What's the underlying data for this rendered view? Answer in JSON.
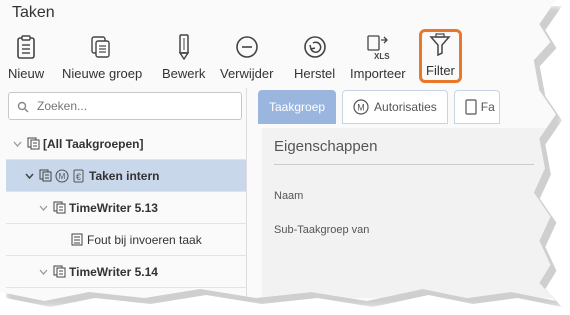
{
  "window": {
    "title": "Taken"
  },
  "toolbar": {
    "buttons": [
      {
        "id": "nieuw",
        "label": "Nieuw",
        "icon": "clipboard-icon"
      },
      {
        "id": "nieuwe-groep",
        "label": "Nieuwe groep",
        "icon": "stacked-clipboards-icon"
      },
      {
        "id": "bewerk",
        "label": "Bewerk",
        "icon": "pencil-icon"
      },
      {
        "id": "verwijder",
        "label": "Verwijder",
        "icon": "minus-circle-icon"
      },
      {
        "id": "herstel",
        "label": "Herstel",
        "icon": "undo-circle-icon"
      },
      {
        "id": "importeer",
        "label": "Importeer",
        "icon": "xls-import-icon"
      },
      {
        "id": "filter",
        "label": "Filter",
        "icon": "funnel-icon"
      }
    ],
    "xls_text": "XLS",
    "highlight_color": "#e9782a"
  },
  "search": {
    "placeholder": "Zoeken..."
  },
  "tree": {
    "items": [
      {
        "label": "[All Taakgroepen]",
        "level": 0,
        "expanded": true,
        "bold": true,
        "selected": false
      },
      {
        "label": "Taken intern",
        "level": 1,
        "expanded": true,
        "bold": true,
        "selected": true,
        "badges": [
          "M",
          "€"
        ]
      },
      {
        "label": "TimeWriter 5.13",
        "level": 2,
        "expanded": true,
        "bold": true,
        "selected": false
      },
      {
        "label": "Fout bij invoeren taak",
        "level": 3,
        "expanded": false,
        "bold": false,
        "selected": false
      },
      {
        "label": "TimeWriter 5.14",
        "level": 2,
        "expanded": true,
        "bold": true,
        "selected": false
      }
    ]
  },
  "tabs": [
    {
      "label": "Taakgroep",
      "active": true
    },
    {
      "label": "Autorisaties",
      "active": false,
      "badge": "M"
    },
    {
      "label": "Fa",
      "active": false
    }
  ],
  "panel": {
    "section_title": "Eigenschappen",
    "fields": [
      "Naam",
      "Sub-Taakgroep van"
    ]
  },
  "colors": {
    "selection": "#c9d7ea",
    "tab_active": "#9ab6de",
    "accent_orange": "#e9782a"
  }
}
